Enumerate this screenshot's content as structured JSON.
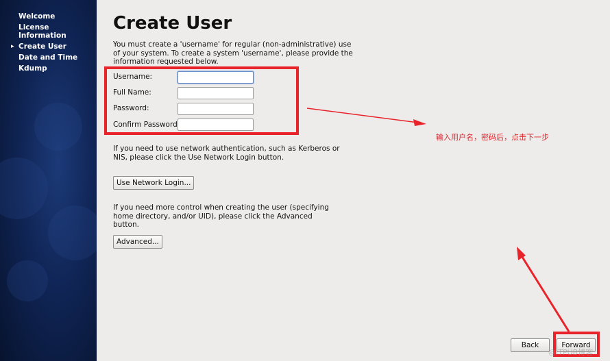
{
  "sidebar": {
    "items": [
      {
        "label": "Welcome"
      },
      {
        "label": "License Information"
      },
      {
        "label": "Create User",
        "active": true
      },
      {
        "label": "Date and Time"
      },
      {
        "label": "Kdump"
      }
    ]
  },
  "page": {
    "title": "Create User",
    "intro": "You must create a 'username' for regular (non-administrative) use of your system.  To create a system 'username', please provide the information requested below."
  },
  "form": {
    "username_label": "Username:",
    "username_value": "",
    "fullname_label": "Full Name:",
    "fullname_value": "",
    "password_label": "Password:",
    "password_value": "",
    "confirm_label": "Confirm Password:",
    "confirm_value": ""
  },
  "network": {
    "text": "If you need to use network authentication, such as Kerberos or NIS, please click the Use Network Login button.",
    "button_label": "Use Network Login..."
  },
  "advanced": {
    "text": "If you need more control when creating the user (specifying home directory, and/or UID), please click the Advanced button.",
    "button_label": "Advanced..."
  },
  "footer": {
    "back_label": "Back",
    "forward_label": "Forward"
  },
  "annotation": {
    "note": "输入用户名，密码后，点击下一步",
    "color": "#e8242a"
  },
  "watermark": "@ITPUB博客"
}
